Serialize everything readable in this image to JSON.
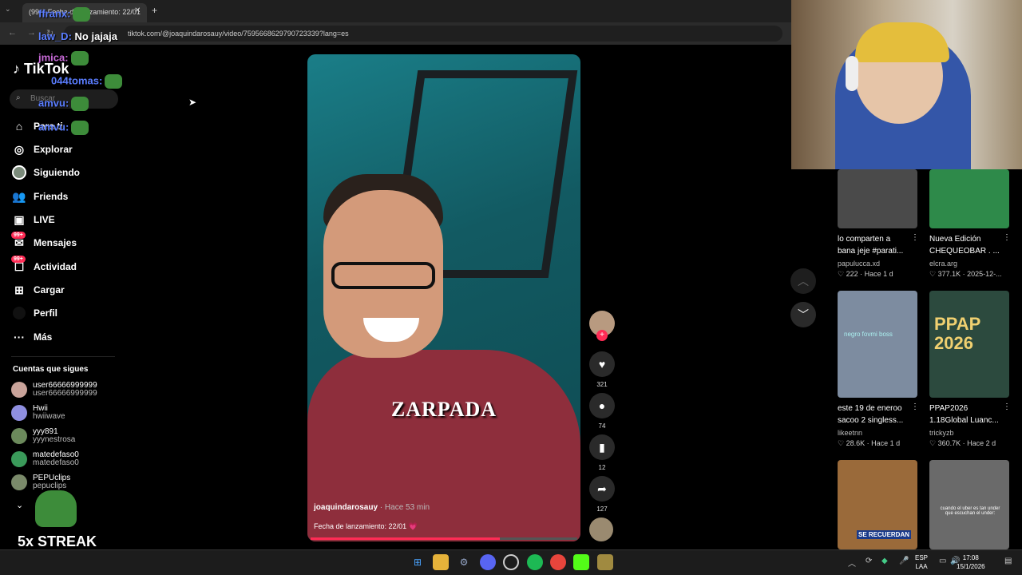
{
  "browser": {
    "tab_title": "(99+) Fecha de lanzamiento: 22/01",
    "url": "tiktok.com/@joaquindarosauy/video/7595668629790723339?lang=es"
  },
  "sidebar": {
    "logo": "TikTok",
    "search_placeholder": "Buscar",
    "items": [
      {
        "label": "Para ti",
        "icon": "home-icon"
      },
      {
        "label": "Explorar",
        "icon": "compass-icon"
      },
      {
        "label": "Siguiendo",
        "icon": "following-avatar-icon"
      },
      {
        "label": "Friends",
        "icon": "friends-icon"
      },
      {
        "label": "LIVE",
        "icon": "live-icon"
      },
      {
        "label": "Mensajes",
        "icon": "message-icon",
        "badge": "99+"
      },
      {
        "label": "Actividad",
        "icon": "activity-icon",
        "badge": "99+"
      },
      {
        "label": "Cargar",
        "icon": "upload-icon"
      },
      {
        "label": "Perfil",
        "icon": "profile-icon"
      },
      {
        "label": "Más",
        "icon": "more-icon"
      }
    ],
    "following_header": "Cuentas que sigues",
    "following": [
      {
        "name": "user66666999999",
        "handle": "user66666999999",
        "color": "#c9a39a"
      },
      {
        "name": "Hwii",
        "handle": "hwiiwave",
        "color": "#8f8fe0"
      },
      {
        "name": "yyy891",
        "handle": "yyynestrosa",
        "color": "#6c8a5c"
      },
      {
        "name": "matedefaso0",
        "handle": "matedefaso0",
        "color": "#3a9a5a"
      },
      {
        "name": "PEPUclips",
        "handle": "pepuclips",
        "color": "#7a8a6a"
      }
    ]
  },
  "chat_overlay": {
    "lines": [
      {
        "user": "ffranx:",
        "text": "",
        "color": "#5a7dff"
      },
      {
        "user": "law_D:",
        "text": "No jajaja",
        "color": "#5a7dff"
      },
      {
        "user": "jmica:",
        "text": "",
        "color": "#c86ad8"
      },
      {
        "user": "044tomas:",
        "text": "",
        "color": "#5a7dff"
      },
      {
        "user": "amvu:",
        "text": "",
        "color": "#5a7dff"
      },
      {
        "user": "amvu:",
        "text": "",
        "color": "#5a7dff"
      }
    ],
    "streak": "5x STREAK"
  },
  "video": {
    "overlay_caption": "ZARPADA",
    "author": "joaquindarosauy",
    "time": "· Hace 53 min",
    "description": "Fecha de lanzamiento: 22/01 💗",
    "progress": 0.71
  },
  "actions": {
    "likes": "321",
    "comments": "74",
    "saves": "12",
    "shares": "127"
  },
  "grid": [
    {
      "title": "lo comparten a",
      "title2": "bana jeje #parati...",
      "author": "papulucca.xd",
      "stats": "♡ 222 · Hace 1 d",
      "color": "#555"
    },
    {
      "title": "Nueva Edición",
      "title2": "CHEQUEOBAR . ...",
      "author": "elcra.arg",
      "stats": "♡ 377.1K · 2025-12-...",
      "color": "#2e8a4a"
    },
    {
      "title": "este 19 de eneroo",
      "title2": "sacoo 2 singless...",
      "author": "likeetnn",
      "stats": "♡ 28.6K · Hace 1 d",
      "color": "#7d8ca0",
      "overlay": "negro fovmi boss"
    },
    {
      "title": "PPAP2026",
      "title2": "1.18Global Luanc...",
      "author": "trickyzb",
      "stats": "♡ 360.7K · Hace 2 d",
      "color": "#2c4a3e",
      "overlay": "PPAP 2026"
    },
    {
      "title": "",
      "title2": "",
      "author": "",
      "stats": "",
      "color": "#9a6a3a",
      "overlay": "SE RECUERDAN"
    },
    {
      "title": "",
      "title2": "",
      "author": "",
      "stats": "",
      "color": "#6a6a6a",
      "overlay": "cuando el uber es tan under que escuchan el under:"
    }
  ],
  "taskbar": {
    "lang1": "ESP",
    "lang2": "LAA",
    "time": "17:08",
    "date": "15/1/2026"
  }
}
